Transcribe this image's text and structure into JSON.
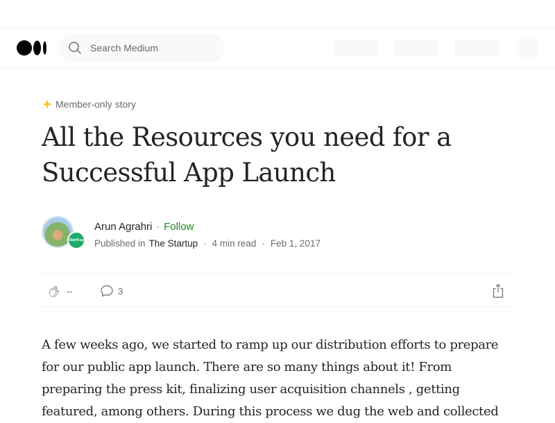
{
  "header": {
    "search": {
      "placeholder": "Search Medium"
    }
  },
  "article": {
    "badge": "Member-only story",
    "title": "All the Resources you need for a Successful App Launch",
    "author": {
      "name": "Arun Agrahri",
      "follow_label": "Follow"
    },
    "publication": {
      "prefix": "Published in",
      "name": "The Startup",
      "avatar_text": "StartKup"
    },
    "read_time": "4 min read",
    "date": "Feb 1, 2017",
    "separator": "·",
    "actions": {
      "claps": "--",
      "responses": "3"
    },
    "body": "A few weeks ago, we started to ramp up our distribution efforts to prepare for our public app launch. There are so many things about it! From preparing the press kit, finalizing user acquisition channels , getting featured, among others. During this process we dug the web and collected"
  },
  "colors": {
    "accent_green": "#1a8917",
    "star_gold": "#ffc017",
    "text_primary": "#242424",
    "text_secondary": "#6b6b6b"
  },
  "icons": {
    "logo": "medium-logo",
    "search": "search-icon",
    "member": "star-icon",
    "clap": "clap-icon",
    "response": "speech-bubble-icon",
    "share": "share-icon"
  }
}
